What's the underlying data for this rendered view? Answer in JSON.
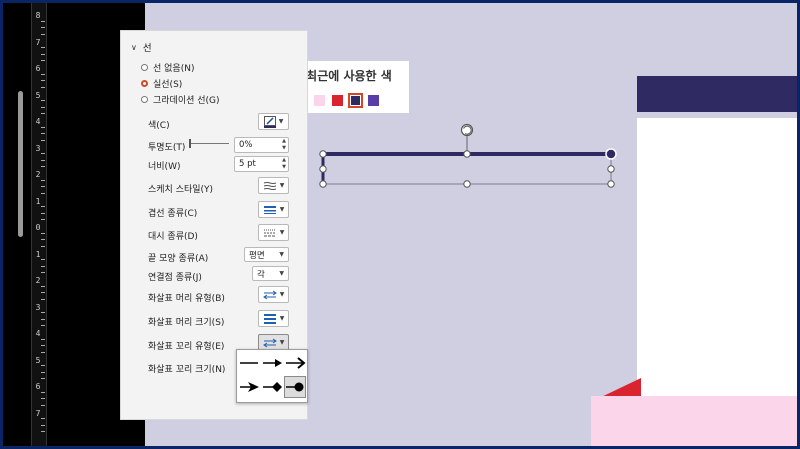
{
  "ruler": {
    "numbers": [
      "8",
      "7",
      "6",
      "5",
      "4",
      "3",
      "2",
      "1",
      "0",
      "1",
      "2",
      "3",
      "4",
      "5",
      "6",
      "7"
    ]
  },
  "panel": {
    "section_title": "선",
    "fill_options": [
      {
        "label": "선 없음(N)",
        "selected": false
      },
      {
        "label": "실선(S)",
        "selected": true
      },
      {
        "label": "그라데이션 선(G)",
        "selected": false
      }
    ],
    "props": {
      "color": "색(C)",
      "transparency": "투명도(T)",
      "width": "너비(W)",
      "sketch": "스케치 스타일(Y)",
      "compound": "겹선 종류(C)",
      "dash": "대시 종류(D)",
      "cap": "끝 모양 종류(A)",
      "join": "연결점 종류(J)",
      "begin_type": "화살표 머리 유형(B)",
      "begin_size": "화살표 머리 크기(S)",
      "end_type": "화살표 꼬리 유형(E)",
      "end_size": "화살표 꼬리 크기(N)"
    },
    "values": {
      "transparency": "0%",
      "width": "5 pt",
      "cap": "평면",
      "join": "각"
    }
  },
  "recent_colors": {
    "title": "최근에 사용한 색",
    "swatches": [
      "#c9c8e0",
      "#fbd6ea",
      "#d9242f",
      "#302a63",
      "#5a3ea8"
    ],
    "selected_index": 3
  },
  "arrow_styles": {
    "options": 6,
    "selected_index": 5
  },
  "colors": {
    "line": "#302a63",
    "accent": "#d24726",
    "slide_band": "#302a63",
    "slide_pink": "#fbd6ea",
    "slide_red": "#d9242f"
  }
}
